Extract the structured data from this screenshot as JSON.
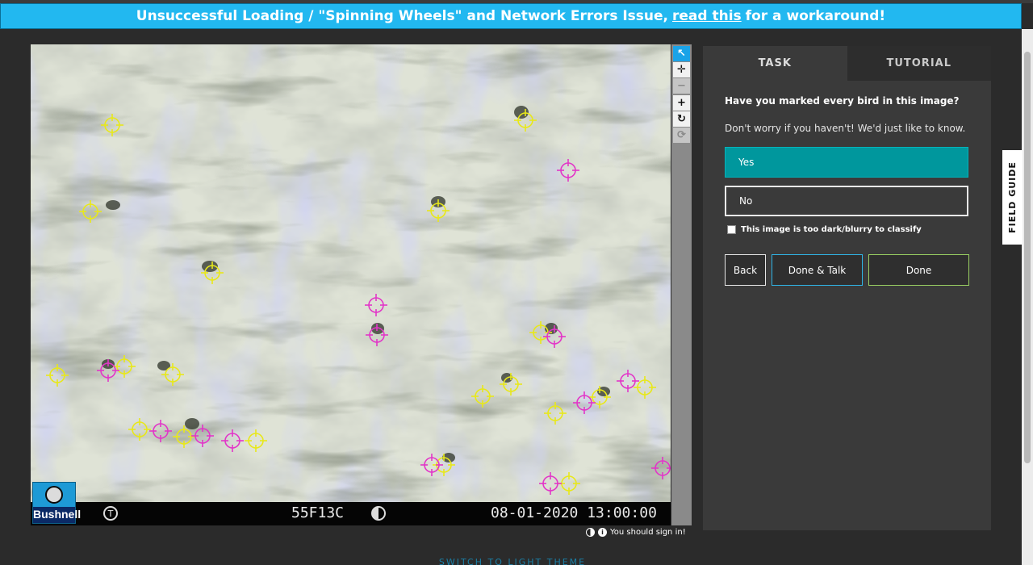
{
  "banner": {
    "prefix": "Unsuccessful Loading / \"Spinning Wheels\" and Network Errors Issue,",
    "link": "read this",
    "suffix": "for a workaround!"
  },
  "camera": {
    "brand": "Bushnell",
    "code": "55F13C",
    "datetime": "08-01-2020 13:00:00",
    "t_label": "T"
  },
  "toolbar": {
    "tools": [
      "pointer-icon",
      "move-icon",
      "zoom-out-icon",
      "zoom-in-icon",
      "rotate-icon",
      "reset-icon"
    ]
  },
  "marks": {
    "yellow_color": "#e8e81a",
    "magenta_color": "#e236c8"
  },
  "footer": {
    "signin": "You should sign in!",
    "theme_switch": "SWITCH TO LIGHT THEME"
  },
  "panel": {
    "tabs": [
      "TASK",
      "TUTORIAL"
    ],
    "question": "Have you marked every bird in this image?",
    "help": "Don't worry if you haven't! We'd just like to know.",
    "answers": [
      "Yes",
      "No"
    ],
    "checkbox_label": "This image is too dark/blurry to classify",
    "buttons": {
      "back": "Back",
      "talk": "Done & Talk",
      "done": "Done"
    },
    "accent": "#00979d"
  },
  "field_guide": "FIELD GUIDE"
}
